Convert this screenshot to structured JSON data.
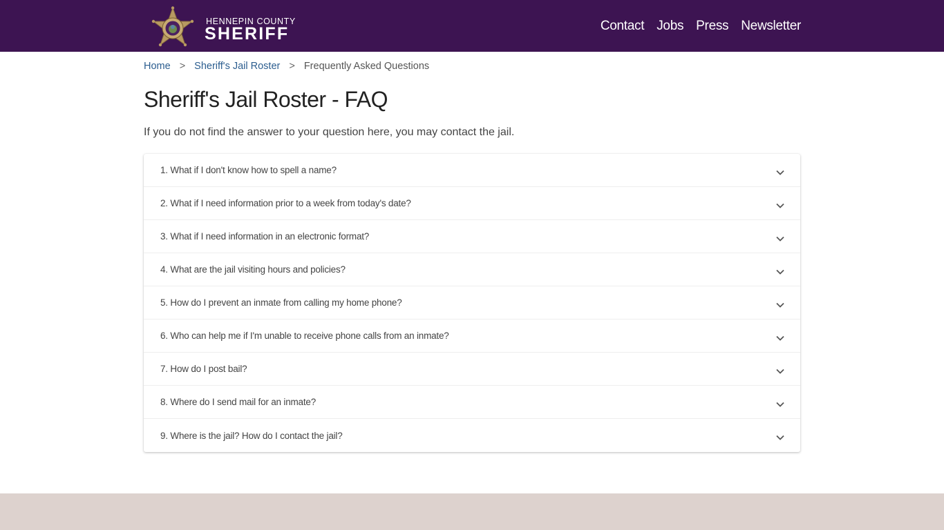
{
  "header": {
    "logo_top": "HENNEPIN COUNTY",
    "logo_main": "SHERIFF",
    "logo_icon": "sheriff-star-badge-icon",
    "nav": [
      {
        "label": "Contact"
      },
      {
        "label": "Jobs"
      },
      {
        "label": "Press"
      },
      {
        "label": "Newsletter"
      }
    ],
    "bg_color": "#3d1452"
  },
  "breadcrumb": {
    "items": [
      {
        "label": "Home"
      },
      {
        "label": "Sheriff's Jail Roster"
      },
      {
        "label": "Frequently Asked Questions"
      }
    ],
    "separator": ">"
  },
  "page": {
    "title": "Sheriff's Jail Roster - FAQ",
    "intro": "If you do not find the answer to your question here, you may contact the jail."
  },
  "faq": {
    "expand_icon": "chevron-down-icon",
    "items": [
      {
        "label": "1. What if I don't know how to spell a name?"
      },
      {
        "label": "2. What if I need information prior to a week from today's date?"
      },
      {
        "label": "3. What if I need information in an electronic format?"
      },
      {
        "label": "4. What are the jail visiting hours and policies?"
      },
      {
        "label": "5. How do I prevent an inmate from calling my home phone?"
      },
      {
        "label": "6. Who can help me if I'm unable to receive phone calls from an inmate?"
      },
      {
        "label": "7. How do I post bail?"
      },
      {
        "label": "8. Where do I send mail for an inmate?"
      },
      {
        "label": "9. Where is the jail? How do I contact the jail?"
      }
    ]
  },
  "footer": {
    "bg_color": "#ddd2ce"
  }
}
